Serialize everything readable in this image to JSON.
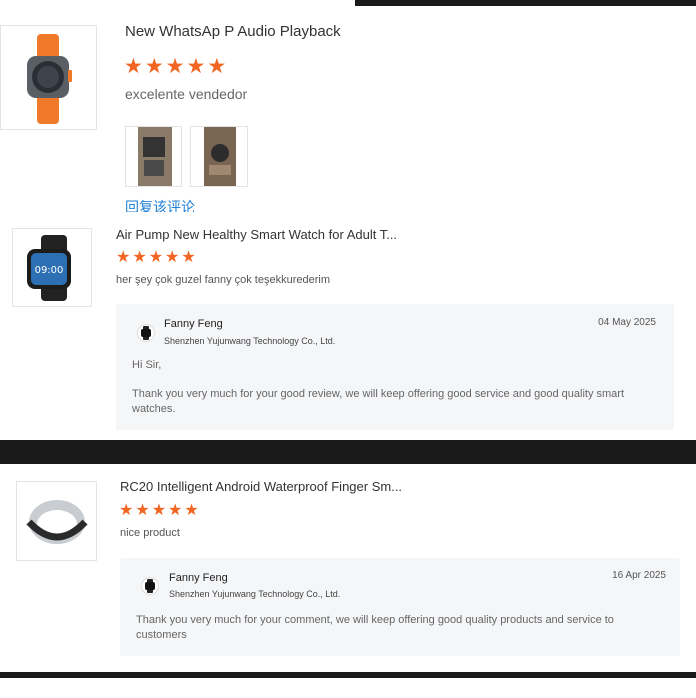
{
  "reviews": [
    {
      "product_title": "New WhatsAp P Audio Playback",
      "rating": 5,
      "comment": "excelente vendedor",
      "attachments": [
        "review-photo-1",
        "review-photo-2"
      ],
      "reply_link": "回复该评论"
    },
    {
      "product_title": "Air Pump New Healthy Smart Watch for Adult T...",
      "rating": 5,
      "comment": "her şey çok guzel fanny çok teşekkurederim",
      "reply": {
        "name": "Fanny Feng",
        "company": "Shenzhen Yujunwang Technology Co., Ltd.",
        "date": "04 May 2025",
        "greeting": "Hi Sir,",
        "text": "Thank you very much for your good review, we will keep offering good service and good quality smart watches."
      }
    },
    {
      "product_title": "RC20 Intelligent Android Waterproof Finger Sm...",
      "rating": 5,
      "comment": "nice product",
      "reply": {
        "name": "Fanny Feng",
        "company": "Shenzhen Yujunwang Technology Co., Ltd.",
        "date": "16 Apr 2025",
        "text": "Thank you very much for your comment, we will keep offering good quality products and service to customers"
      }
    }
  ],
  "colors": {
    "star": "#f26522",
    "link": "#1e7fd6",
    "reply_bg": "#f5f6f8"
  },
  "icons": {
    "rating": "star-icon",
    "avatar": "seller-avatar-icon"
  }
}
